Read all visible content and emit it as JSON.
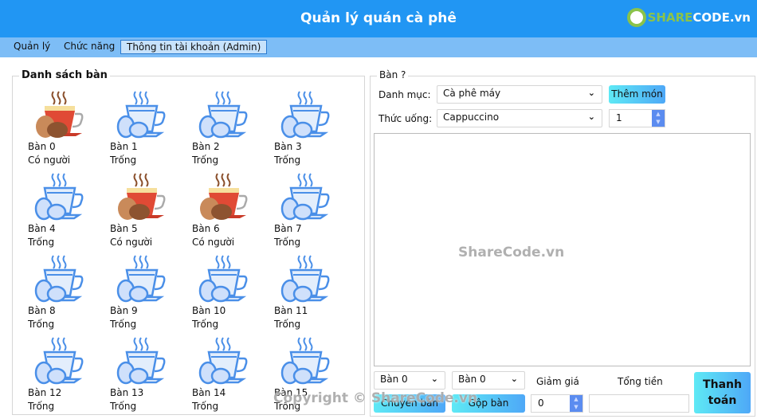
{
  "header": {
    "title": "Quản lý quán cà phê",
    "logo_text": "SHARECODE.vn"
  },
  "menu": [
    {
      "label": "Quản lý"
    },
    {
      "label": "Chức năng"
    },
    {
      "label": "Thông tin tài khoản (Admin)"
    }
  ],
  "tables_group": {
    "title": "Danh sách bàn"
  },
  "tables": [
    {
      "name": "Bàn 0",
      "status": "Có người"
    },
    {
      "name": "Bàn 1",
      "status": "Trống"
    },
    {
      "name": "Bàn 2",
      "status": "Trống"
    },
    {
      "name": "Bàn 3",
      "status": "Trống"
    },
    {
      "name": "Bàn 4",
      "status": "Trống"
    },
    {
      "name": "Bàn 5",
      "status": "Có người"
    },
    {
      "name": "Bàn 6",
      "status": "Có người"
    },
    {
      "name": "Bàn 7",
      "status": "Trống"
    },
    {
      "name": "Bàn 8",
      "status": "Trống"
    },
    {
      "name": "Bàn 9",
      "status": "Trống"
    },
    {
      "name": "Bàn 10",
      "status": "Trống"
    },
    {
      "name": "Bàn 11",
      "status": "Trống"
    },
    {
      "name": "Bàn 12",
      "status": "Trống"
    },
    {
      "name": "Bàn 13",
      "status": "Trống"
    },
    {
      "name": "Bàn 14",
      "status": "Trống"
    },
    {
      "name": "Bàn 15",
      "status": "Trống"
    }
  ],
  "order": {
    "title": "Bàn ?",
    "category_label": "Danh mục:",
    "category_value": "Cà phê máy",
    "drink_label": "Thức uống:",
    "drink_value": "Cappuccino",
    "add_button": "Thêm món",
    "quantity": "1"
  },
  "bottom": {
    "switch_from": "Bàn 0",
    "merge_from": "Bàn 0",
    "switch_button": "Chuyển bàn",
    "merge_button": "Gộp bàn",
    "discount_label": "Giảm giá",
    "discount_value": "0",
    "total_label": "Tổng tiền",
    "total_value": "",
    "pay_button": "Thanh toán"
  },
  "watermarks": {
    "center": "ShareCode.vn",
    "bottom": "Copyright © ShareCode.vn"
  },
  "colors": {
    "header": "#2196f3",
    "menubar": "#7dbdf6",
    "occupied_cup": "#e04a35",
    "empty_cup": "#4a8fe8"
  }
}
